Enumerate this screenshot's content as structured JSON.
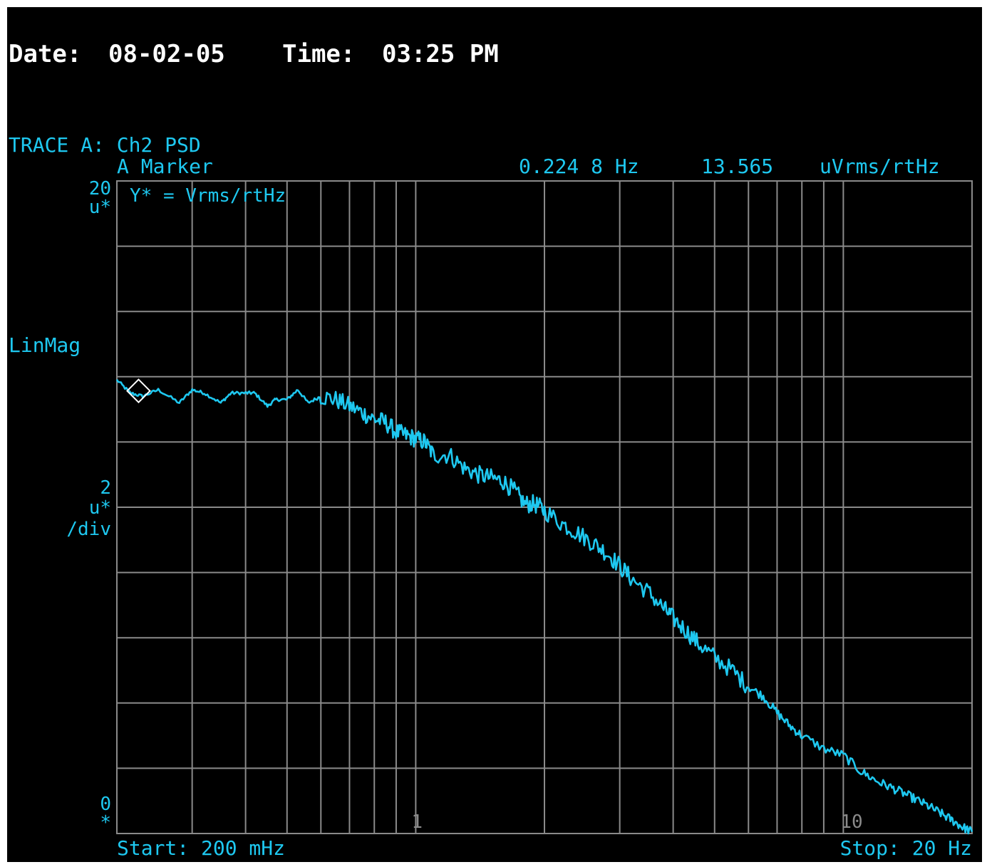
{
  "header": {
    "date_label": "Date:",
    "date_value": "08-02-05",
    "time_label": "Time:",
    "time_value": "03:25 PM"
  },
  "trace": {
    "title": "TRACE A: Ch2 PSD",
    "marker_label": "A Marker",
    "marker_freq": "0.224 8 Hz",
    "marker_value": "13.565",
    "marker_unit": "uVrms/rtHz",
    "y_unit_note": "Y* = Vrms/rtHz",
    "scale_mode": "LinMag",
    "y_top_value": "20",
    "y_top_unit": "u*",
    "y_div_value": "2",
    "y_div_unit": "u*",
    "y_div_suffix": "/div",
    "y_bottom_value": "0",
    "y_bottom_unit": "*",
    "start_label": "Start: 200 mHz",
    "stop_label": "Stop: 20 Hz",
    "x_tick_1": "1",
    "x_tick_10": "10"
  },
  "colors": {
    "background": "#000000",
    "trace": "#1ec8f0",
    "grid": "#8a8a8a",
    "header_text": "#ffffff",
    "marker": "#ffffff"
  },
  "chart_data": {
    "type": "line",
    "title": "TRACE A: Ch2 PSD",
    "xlabel": "",
    "ylabel": "",
    "x_scale": "log",
    "xlim": [
      0.2,
      20
    ],
    "ylim": [
      0,
      20
    ],
    "grid": true,
    "y_divisions": 10,
    "x_tick_labels": [
      {
        "value": 1,
        "label": "1"
      },
      {
        "value": 10,
        "label": "10"
      }
    ],
    "marker": {
      "x": 0.2248,
      "y": 13.565
    },
    "series": [
      {
        "x": [
          0.2,
          0.215,
          0.23,
          0.25,
          0.28,
          0.3,
          0.32,
          0.35,
          0.37,
          0.4,
          0.42,
          0.45,
          0.47,
          0.5,
          0.53,
          0.56,
          0.6,
          0.65,
          0.7,
          0.75,
          0.8,
          0.85,
          0.9,
          0.95,
          1.0,
          1.05,
          1.1,
          1.2,
          1.3,
          1.4,
          1.5,
          1.6,
          1.7,
          1.8,
          1.9,
          2.0,
          2.2,
          2.4,
          2.6,
          2.8,
          3.0,
          3.2,
          3.5,
          3.8,
          4.0,
          4.3,
          4.6,
          5.0,
          5.5,
          6.0,
          6.5,
          7.0,
          7.5,
          8.0,
          9.0,
          10.0,
          11.0,
          12.0,
          13.0,
          14.0,
          15.0,
          16.0,
          17.0,
          18.0,
          19.0,
          20.0
        ],
        "values": [
          13.9,
          13.5,
          13.4,
          13.6,
          13.2,
          13.6,
          13.5,
          13.2,
          13.5,
          13.5,
          13.5,
          13.1,
          13.3,
          13.3,
          13.6,
          13.2,
          13.4,
          13.3,
          13.1,
          12.9,
          12.7,
          12.6,
          12.3,
          12.2,
          12.1,
          12.0,
          11.6,
          11.6,
          11.2,
          11.0,
          10.9,
          10.8,
          10.5,
          10.1,
          10.1,
          9.9,
          9.5,
          9.2,
          8.9,
          8.6,
          8.2,
          7.8,
          7.4,
          6.9,
          6.6,
          6.2,
          5.8,
          5.4,
          5.0,
          4.5,
          4.2,
          3.7,
          3.3,
          3.0,
          2.6,
          2.4,
          1.9,
          1.6,
          1.4,
          1.2,
          1.0,
          0.8,
          0.6,
          0.4,
          0.2,
          0.05
        ]
      }
    ]
  }
}
